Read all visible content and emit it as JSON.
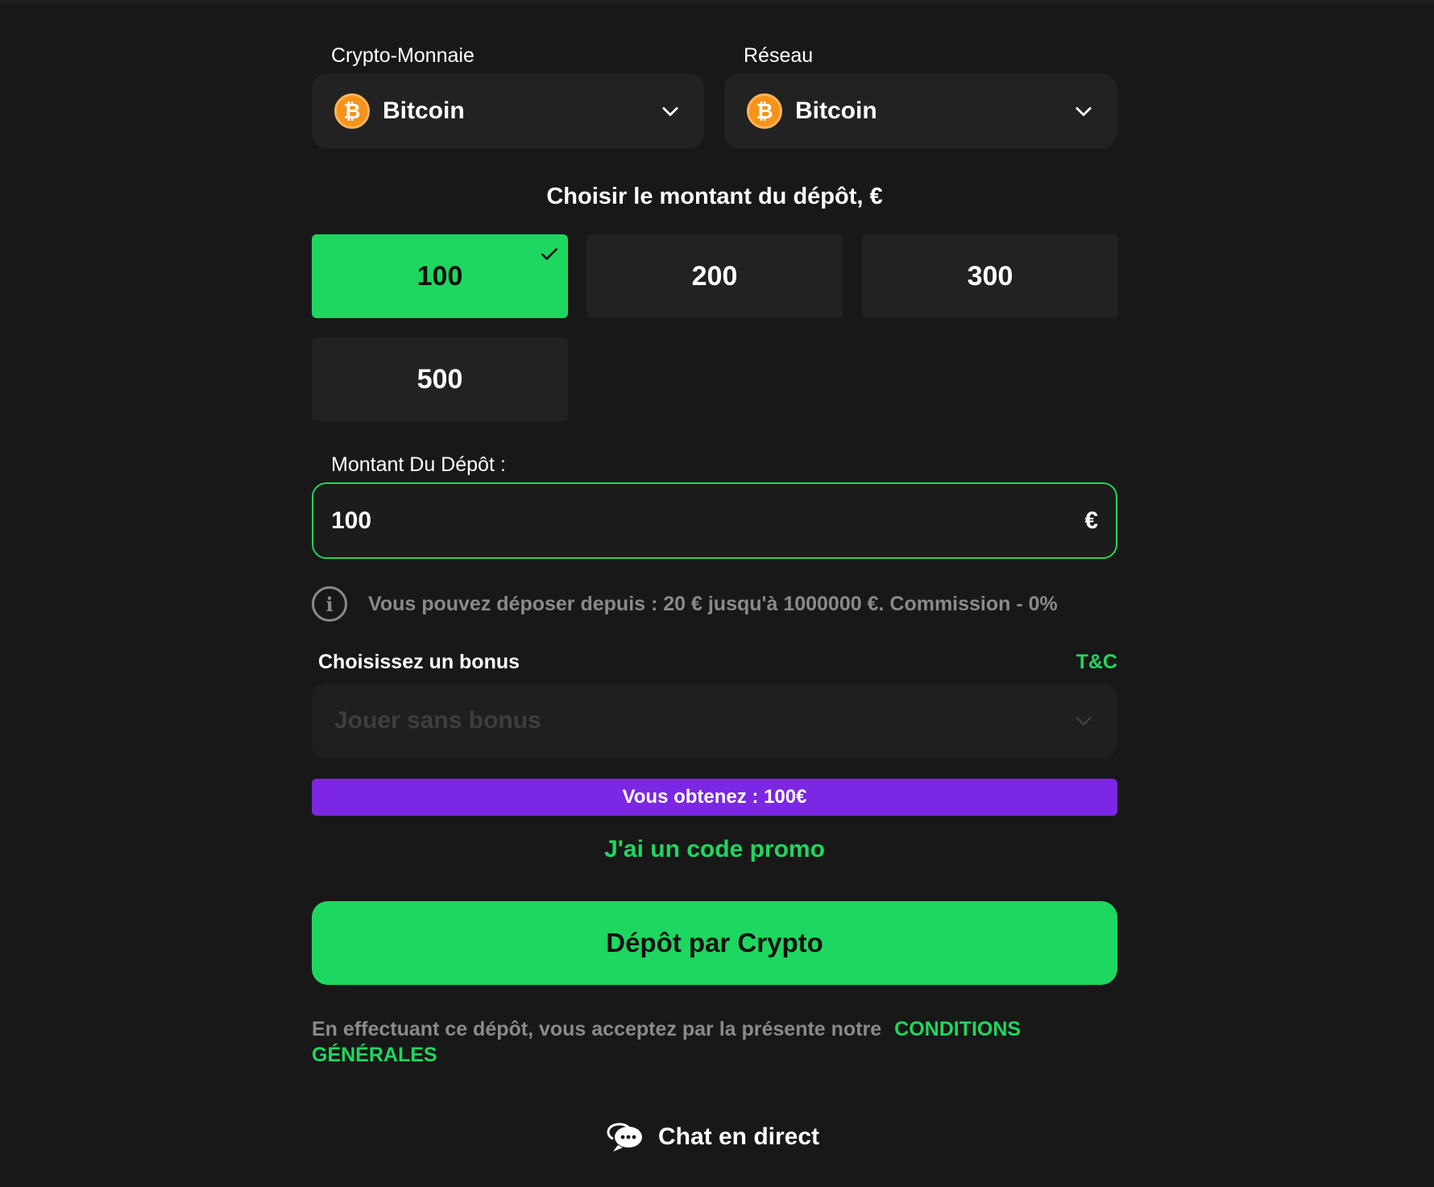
{
  "crypto": {
    "label": "Crypto-Monnaie",
    "value": "Bitcoin",
    "icon": "bitcoin-icon"
  },
  "network": {
    "label": "Réseau",
    "value": "Bitcoin",
    "icon": "bitcoin-icon"
  },
  "amount_section": {
    "title": "Choisir le montant du dépôt, €",
    "options": [
      "100",
      "200",
      "300",
      "500"
    ],
    "selected": "100"
  },
  "deposit_amount": {
    "label": "Montant Du Dépôt :",
    "value": "100",
    "currency": "€"
  },
  "info": {
    "text": "Vous pouvez déposer depuis : 20 € jusqu'à 1000000 €. Commission - 0%"
  },
  "bonus": {
    "title": "Choisissez un bonus",
    "tc_label": "T&C",
    "placeholder": "Jouer sans bonus"
  },
  "obtain": {
    "text": "Vous obtenez : 100€"
  },
  "promo": {
    "label": "J'ai un code promo"
  },
  "submit": {
    "label": "Dépôt par Crypto"
  },
  "terms": {
    "text": "En effectuant ce dépôt, vous acceptez par la présente notre",
    "link": "CONDITIONS GÉNÉRALES"
  },
  "chat": {
    "label": "Chat en direct",
    "icon": "chat-bubble-icon"
  },
  "colors": {
    "accent": "#1ed760",
    "purple": "#7b27e3",
    "background": "#181818",
    "field": "#222222",
    "bitcoin": "#f7931a"
  }
}
